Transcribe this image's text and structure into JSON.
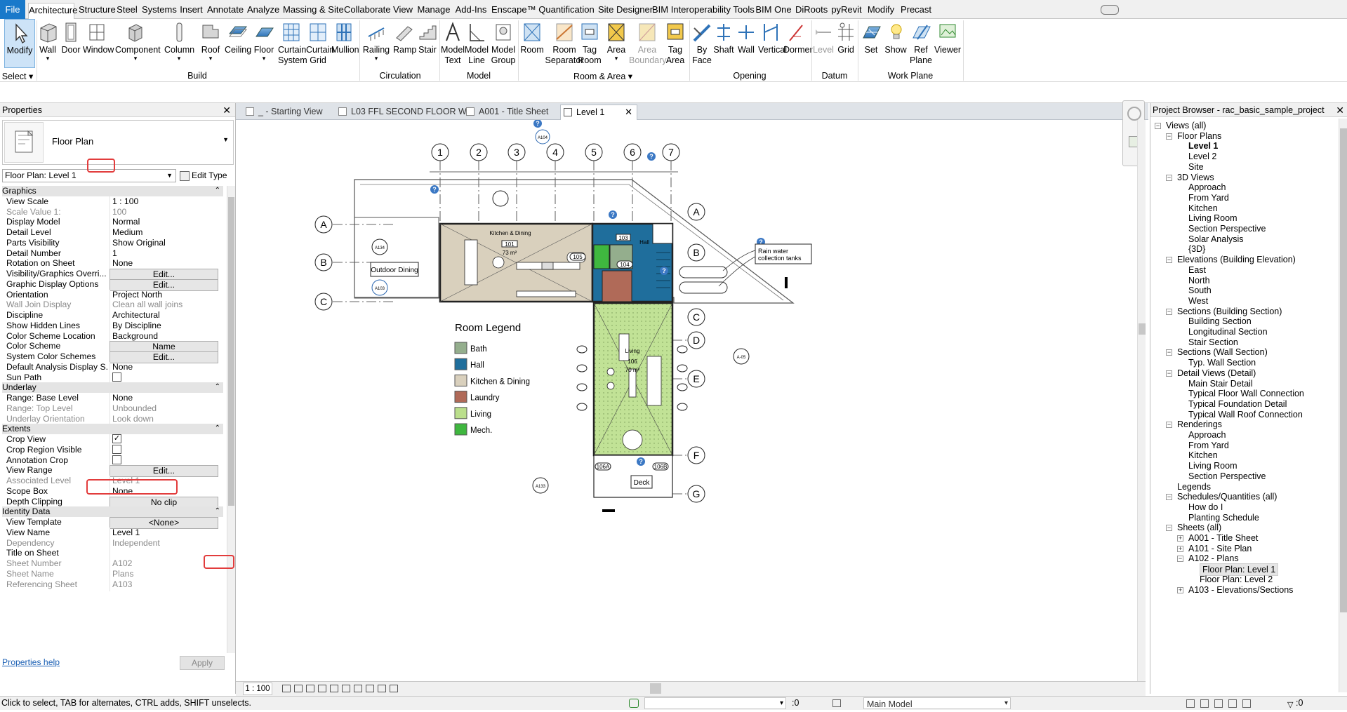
{
  "ribbon_tabs": [
    {
      "label": "File"
    },
    {
      "label": "Architecture"
    },
    {
      "label": "Structure"
    },
    {
      "label": "Steel"
    },
    {
      "label": "Systems"
    },
    {
      "label": "Insert"
    },
    {
      "label": "Annotate"
    },
    {
      "label": "Analyze"
    },
    {
      "label": "Massing & Site"
    },
    {
      "label": "Collaborate"
    },
    {
      "label": "View"
    },
    {
      "label": "Manage"
    },
    {
      "label": "Add-Ins"
    },
    {
      "label": "Enscape™"
    },
    {
      "label": "Quantification"
    },
    {
      "label": "Site Designer"
    },
    {
      "label": "BIM Interoperability Tools"
    },
    {
      "label": "BIM One"
    },
    {
      "label": "DiRoots"
    },
    {
      "label": "pyRevit"
    },
    {
      "label": "Modify"
    },
    {
      "label": "Precast"
    }
  ],
  "ribbon": {
    "buttons": [
      {
        "l1": "Modify",
        "l2": ""
      },
      {
        "l1": "Wall",
        "l2": ""
      },
      {
        "l1": "Door",
        "l2": ""
      },
      {
        "l1": "Window",
        "l2": ""
      },
      {
        "l1": "Component",
        "l2": ""
      },
      {
        "l1": "Column",
        "l2": ""
      },
      {
        "l1": "Roof",
        "l2": ""
      },
      {
        "l1": "Ceiling",
        "l2": ""
      },
      {
        "l1": "Floor",
        "l2": ""
      },
      {
        "l1": "Curtain",
        "l2": "System"
      },
      {
        "l1": "Curtain",
        "l2": "Grid"
      },
      {
        "l1": "Mullion",
        "l2": ""
      },
      {
        "l1": "Railing",
        "l2": ""
      },
      {
        "l1": "Ramp",
        "l2": ""
      },
      {
        "l1": "Stair",
        "l2": ""
      },
      {
        "l1": "Model",
        "l2": "Text"
      },
      {
        "l1": "Model",
        "l2": "Line"
      },
      {
        "l1": "Model",
        "l2": "Group"
      },
      {
        "l1": "Room",
        "l2": ""
      },
      {
        "l1": "Room",
        "l2": "Separator"
      },
      {
        "l1": "Tag",
        "l2": "Room"
      },
      {
        "l1": "Area",
        "l2": ""
      },
      {
        "l1": "Area",
        "l2": "Boundary"
      },
      {
        "l1": "Tag",
        "l2": "Area"
      },
      {
        "l1": "By",
        "l2": "Face"
      },
      {
        "l1": "Shaft",
        "l2": ""
      },
      {
        "l1": "Wall",
        "l2": ""
      },
      {
        "l1": "Vertical",
        "l2": ""
      },
      {
        "l1": "Dormer",
        "l2": ""
      },
      {
        "l1": "Level",
        "l2": ""
      },
      {
        "l1": "Grid",
        "l2": ""
      },
      {
        "l1": "Set",
        "l2": ""
      },
      {
        "l1": "Show",
        "l2": ""
      },
      {
        "l1": "Ref",
        "l2": "Plane"
      },
      {
        "l1": "Viewer",
        "l2": ""
      }
    ],
    "groups": [
      {
        "label": "Select ▾"
      },
      {
        "label": "Build"
      },
      {
        "label": "Circulation"
      },
      {
        "label": "Model"
      },
      {
        "label": "Room & Area ▾"
      },
      {
        "label": "Opening"
      },
      {
        "label": "Datum"
      },
      {
        "label": "Work Plane"
      }
    ]
  },
  "properties": {
    "title": "Properties",
    "type_name": "Floor Plan",
    "instance_selector": "Floor Plan: Level 1",
    "edit_type": "Edit Type",
    "rows": [
      {
        "k": "Graphics",
        "v": ""
      },
      {
        "k": "View Scale",
        "v": "1 : 100"
      },
      {
        "k": "Scale Value    1:",
        "v": "100"
      },
      {
        "k": "Display Model",
        "v": "Normal"
      },
      {
        "k": "Detail Level",
        "v": "Medium"
      },
      {
        "k": "Parts Visibility",
        "v": "Show Original"
      },
      {
        "k": "Detail Number",
        "v": "1"
      },
      {
        "k": "Rotation on Sheet",
        "v": "None"
      },
      {
        "k": "Visibility/Graphics Overri...",
        "v": "Edit..."
      },
      {
        "k": "Graphic Display Options",
        "v": "Edit..."
      },
      {
        "k": "Orientation",
        "v": "Project North"
      },
      {
        "k": "Wall Join Display",
        "v": "Clean all wall joins"
      },
      {
        "k": "Discipline",
        "v": "Architectural"
      },
      {
        "k": "Show Hidden Lines",
        "v": "By Discipline"
      },
      {
        "k": "Color Scheme Location",
        "v": "Background"
      },
      {
        "k": "Color Scheme",
        "v": "Name"
      },
      {
        "k": "System Color Schemes",
        "v": "Edit..."
      },
      {
        "k": "Default Analysis Display S...",
        "v": "None"
      },
      {
        "k": "Sun Path",
        "v": ""
      },
      {
        "k": "Underlay",
        "v": ""
      },
      {
        "k": "Range: Base Level",
        "v": "None"
      },
      {
        "k": "Range: Top Level",
        "v": "Unbounded"
      },
      {
        "k": "Underlay Orientation",
        "v": "Look down"
      },
      {
        "k": "Extents",
        "v": ""
      },
      {
        "k": "Crop View",
        "v": ""
      },
      {
        "k": "Crop Region Visible",
        "v": ""
      },
      {
        "k": "Annotation Crop",
        "v": ""
      },
      {
        "k": "View Range",
        "v": "Edit..."
      },
      {
        "k": "Associated Level",
        "v": "Level 1"
      },
      {
        "k": "Scope Box",
        "v": "None"
      },
      {
        "k": "Depth Clipping",
        "v": "No clip"
      },
      {
        "k": "Identity Data",
        "v": ""
      },
      {
        "k": "View Template",
        "v": "<None>"
      },
      {
        "k": "View Name",
        "v": "Level 1"
      },
      {
        "k": "Dependency",
        "v": "Independent"
      },
      {
        "k": "Title on Sheet",
        "v": ""
      },
      {
        "k": "Sheet Number",
        "v": "A102"
      },
      {
        "k": "Sheet Name",
        "v": "Plans"
      },
      {
        "k": "Referencing Sheet",
        "v": "A103"
      }
    ],
    "help": "Properties help",
    "apply": "Apply"
  },
  "view_tabs": [
    {
      "label": "_ - Starting View"
    },
    {
      "label": "L03 FFL SECOND FLOOR WIP"
    },
    {
      "label": "A001 - Title Sheet"
    },
    {
      "label": "Level 1"
    }
  ],
  "drawing": {
    "grid_cols": [
      "1",
      "2",
      "3",
      "4",
      "5",
      "6",
      "7"
    ],
    "grid_rows_left": [
      "A",
      "B",
      "C"
    ],
    "grid_rows_right": [
      "A",
      "B",
      "C",
      "D",
      "E",
      "F",
      "G"
    ],
    "kitchen_label": "Kitchen & Dining",
    "kitchen_num": "101",
    "kitchen_area": "73 m²",
    "hall_label": "Hall",
    "hall_num": "103",
    "living_label": "Living",
    "living_num": "106",
    "living_area": "70 m²",
    "outdoor": "Outdoor Dining",
    "rain1": "Rain water",
    "rain2": "collection tanks",
    "deck": "Deck",
    "door_tags": [
      "105",
      "104",
      "106A",
      "106B"
    ],
    "sec_tags": [
      "A134",
      "A103",
      "A104",
      "A133",
      "A-05"
    ],
    "legend_title": "Room Legend",
    "legend": [
      {
        "name": "Bath",
        "color": "#94ae8d"
      },
      {
        "name": "Hall",
        "color": "#1f6e9c"
      },
      {
        "name": "Kitchen & Dining",
        "color": "#d9d0bd"
      },
      {
        "name": "Laundry",
        "color": "#b06a58"
      },
      {
        "name": "Living",
        "color": "#bbdf8c"
      },
      {
        "name": "Mech.",
        "color": "#3fb73f"
      }
    ]
  },
  "view_control": {
    "scale": "1 : 100"
  },
  "project_browser": {
    "title": "Project Browser - rac_basic_sample_project",
    "nodes": [
      {
        "label": "Views (all)"
      },
      {
        "label": "Floor Plans"
      },
      {
        "label": "Level 1"
      },
      {
        "label": "Level 2"
      },
      {
        "label": "Site"
      },
      {
        "label": "3D Views"
      },
      {
        "label": "Approach"
      },
      {
        "label": "From Yard"
      },
      {
        "label": "Kitchen"
      },
      {
        "label": "Living Room"
      },
      {
        "label": "Section Perspective"
      },
      {
        "label": "Solar Analysis"
      },
      {
        "label": "{3D}"
      },
      {
        "label": "Elevations (Building Elevation)"
      },
      {
        "label": "East"
      },
      {
        "label": "North"
      },
      {
        "label": "South"
      },
      {
        "label": "West"
      },
      {
        "label": "Sections (Building Section)"
      },
      {
        "label": "Building Section"
      },
      {
        "label": "Longitudinal Section"
      },
      {
        "label": "Stair Section"
      },
      {
        "label": "Sections (Wall Section)"
      },
      {
        "label": "Typ. Wall Section"
      },
      {
        "label": "Detail Views (Detail)"
      },
      {
        "label": "Main Stair Detail"
      },
      {
        "label": "Typical Floor Wall Connection"
      },
      {
        "label": "Typical Foundation Detail"
      },
      {
        "label": "Typical Wall Roof Connection"
      },
      {
        "label": "Renderings"
      },
      {
        "label": "Approach"
      },
      {
        "label": "From Yard"
      },
      {
        "label": "Kitchen"
      },
      {
        "label": "Living Room"
      },
      {
        "label": "Section Perspective"
      },
      {
        "label": "Legends"
      },
      {
        "label": "Schedules/Quantities (all)"
      },
      {
        "label": "How do I"
      },
      {
        "label": "Planting Schedule"
      },
      {
        "label": "Sheets (all)"
      },
      {
        "label": "A001 - Title Sheet"
      },
      {
        "label": "A101 - Site Plan"
      },
      {
        "label": "A102 - Plans"
      },
      {
        "label": "Floor Plan: Level 1"
      },
      {
        "label": "Floor Plan: Level 2"
      },
      {
        "label": "A103 - Elevations/Sections"
      }
    ]
  },
  "status": {
    "hint": "Click to select, TAB for alternates, CTRL adds, SHIFT unselects.",
    "zero": ":0",
    "model": "Main Model",
    "filter": ":0"
  }
}
